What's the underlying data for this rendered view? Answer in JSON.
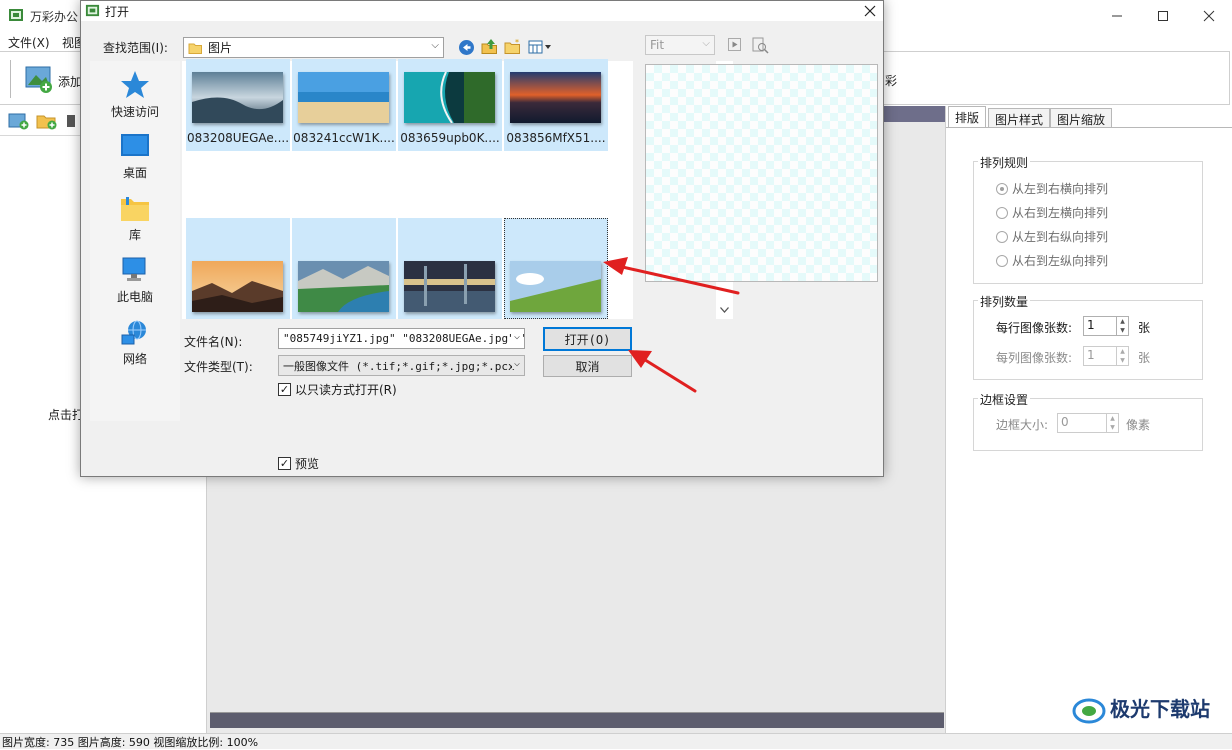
{
  "app": {
    "title": "万彩办公",
    "menu": [
      "文件(X)",
      "视图"
    ],
    "toolbar": {
      "add_label": "添加",
      "right_label": "彩"
    },
    "left_panel": {
      "hint": "点击打"
    },
    "tabs": [
      "排版",
      "图片样式",
      "图片缩放"
    ],
    "layout_rules": {
      "title": "排列规则",
      "options": [
        "从左到右横向排列",
        "从右到左横向排列",
        "从左到右纵向排列",
        "从右到左纵向排列"
      ]
    },
    "count": {
      "title": "排列数量",
      "per_row_label": "每行图像张数:",
      "per_row_value": "1",
      "per_col_label": "每列图像张数:",
      "per_col_value": "1",
      "unit": "张"
    },
    "border": {
      "title": "边框设置",
      "size_label": "边框大小:",
      "size_value": "0",
      "unit": "像素"
    },
    "status": "图片宽度: 735 图片高度: 590 视图缩放比例: 100%"
  },
  "dialog": {
    "title": "打开",
    "look_in_label": "查找范围(I):",
    "look_in_value": "图片",
    "preview_fit": "Fit",
    "places": [
      "快速访问",
      "桌面",
      "库",
      "此电脑",
      "网络"
    ],
    "files_row1": [
      "083208UEGAe....",
      "083241ccW1K....",
      "083659upb0K....",
      "083856MfX51...."
    ],
    "filename_label": "文件名(N):",
    "filename_value": "\"085749jiYZ1.jpg\" \"083208UEGAe.jpg\" \"",
    "filetype_label": "文件类型(T):",
    "filetype_value": "一般图像文件 (*.tif;*.gif;*.jpg;*.pcx",
    "open_button": "打开(O)",
    "cancel_button": "取消",
    "readonly_label": "以只读方式打开(R)",
    "preview_label": "预览"
  },
  "watermark": "极光下载站",
  "colors": {
    "selection": "#cde8fb",
    "accent": "#0078d7",
    "annotation_arrow": "#e02020"
  }
}
